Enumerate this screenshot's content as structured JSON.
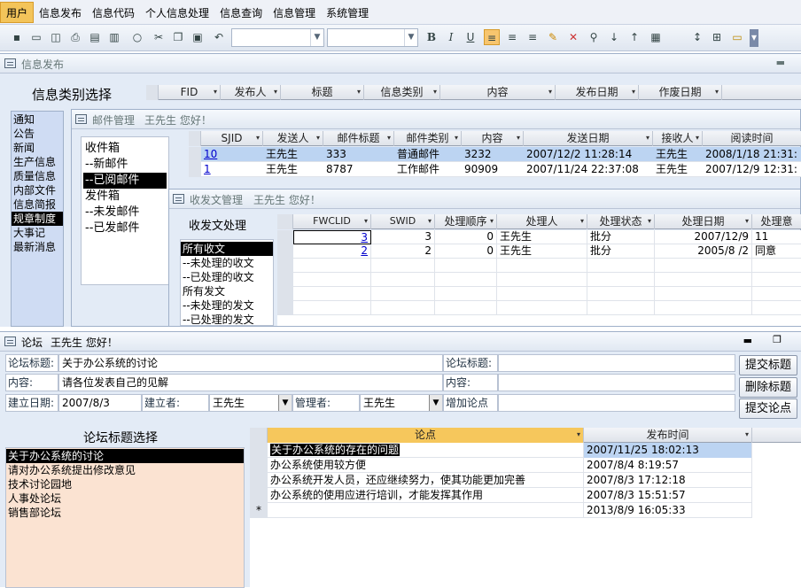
{
  "menubar": {
    "items": [
      "用户",
      "信息发布",
      "信息代码",
      "个人信息处理",
      "信息查询",
      "信息管理",
      "系统管理"
    ]
  },
  "toolbar": {
    "icons": [
      "save-icon",
      "open-icon",
      "print-preview-icon",
      "print-icon",
      "layout-icon",
      "layout2-icon",
      "zoom-icon",
      "cut-icon",
      "copy-icon",
      "paste-icon",
      "undo-icon",
      "bold-icon",
      "italic-icon",
      "underline-icon",
      "align-left-icon",
      "align-center-icon",
      "align-right-icon",
      "highlight-icon",
      "eraser-icon",
      "find-icon",
      "sort-asc-icon",
      "sort-desc-icon",
      "grid-icon",
      "line-spacing-icon",
      "insert-icon",
      "folder-icon",
      "more-icon"
    ],
    "bold": "B",
    "italic": "I",
    "underline": "U",
    "accent": "#f7c56e"
  },
  "xinxi": {
    "title": "信息发布",
    "category_title": "信息类别选择",
    "columns": [
      "FID",
      "发布人",
      "标题",
      "信息类别",
      "内容",
      "发布日期",
      "作废日期"
    ],
    "categories": [
      "通知",
      "公告",
      "新闻",
      "生产信息",
      "质量信息",
      "内部文件",
      "信息简报",
      "规章制度",
      "大事记",
      "最新消息"
    ],
    "selected_category": "规章制度"
  },
  "mail": {
    "title": "邮件管理",
    "greeting": "王先生 您好！",
    "folders": [
      "收件箱",
      "--新邮件",
      "--已阅邮件",
      "发件箱",
      "--未发邮件",
      "--已发邮件"
    ],
    "selected_folder": "--已阅邮件",
    "columns": [
      "SJID",
      "发送人",
      "邮件标题",
      "邮件类别",
      "内容",
      "发送日期",
      "接收人",
      "阅读时间"
    ],
    "rows": [
      [
        "10",
        "王先生",
        "333",
        "普通邮件",
        "3232",
        "2007/12/2 11:28:14",
        "王先生",
        "2008/1/18 21:31:"
      ],
      [
        "1",
        "王先生",
        "8787",
        "工作邮件",
        "90909",
        "2007/11/24 22:37:08",
        "王先生",
        "2007/12/9 12:31:"
      ]
    ]
  },
  "shoufa": {
    "title": "收发文管理",
    "greeting": "王先生 您好！",
    "section": "收发文处理",
    "items": [
      "所有收文",
      "--未处理的收文",
      "--已处理的收文",
      "所有发文",
      "--未处理的发文",
      "--已处理的发文"
    ],
    "selected": "所有收文",
    "columns": [
      "FWCLID",
      "SWID",
      "处理顺序",
      "处理人",
      "处理状态",
      "处理日期",
      "处理意"
    ],
    "rows": [
      [
        "3",
        "3",
        "0",
        "王先生",
        "批分",
        "2007/12/9",
        "11"
      ],
      [
        "2",
        "2",
        "0",
        "王先生",
        "批分",
        "2005/8 /2",
        "同意"
      ]
    ]
  },
  "forum": {
    "title": "论坛",
    "greeting": "王先生 您好！",
    "labels": {
      "title": "论坛标题:",
      "content": "内容:",
      "created": "建立日期:",
      "creator": "建立者:",
      "admin": "管理者:",
      "title2": "论坛标题:",
      "content2": "内容:",
      "add_point": "增加论点"
    },
    "values": {
      "title": "关于办公系统的讨论",
      "content": "请各位发表自己的见解",
      "created": "2007/8/3",
      "creator": "王先生",
      "admin": "王先生"
    },
    "buttons": [
      "提交标题",
      "删除标题",
      "提交论点"
    ],
    "select_title": "论坛标题选择",
    "topics": [
      "关于办公系统的讨论",
      "请对办公系统提出修改意见",
      "技术讨论园地",
      "人事处论坛",
      "销售部论坛"
    ],
    "selected_topic": "关于办公系统的讨论",
    "columns": [
      "论点",
      "发布时间"
    ],
    "rows": [
      [
        "关于办公系统的存在的问题",
        "2007/11/25 18:02:13"
      ],
      [
        "办公系统使用较方便",
        "2007/8/4 8:19:57"
      ],
      [
        "办公系统开发人员，还应继续努力，使其功能更加完善",
        "2007/8/3 17:12:18"
      ],
      [
        "办公系统的使用应进行培训，才能发挥其作用",
        "2007/8/3 15:51:57"
      ],
      [
        "",
        "2013/8/9 16:05:33"
      ]
    ],
    "new_row_marker": "*"
  }
}
